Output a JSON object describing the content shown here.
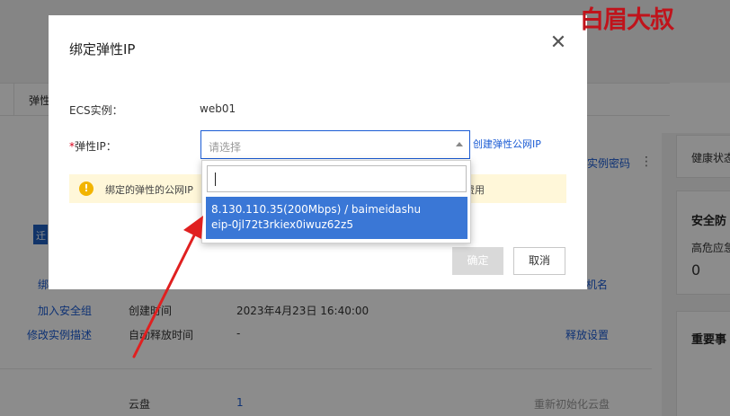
{
  "watermark": {
    "text": "白眉大叔"
  },
  "background": {
    "tab_label": "弹性",
    "chip_label": "迁",
    "rows": [
      {
        "action": "绑",
        "key": "",
        "value": "",
        "right": "机名"
      },
      {
        "action": "加入安全组",
        "key": "创建时间",
        "value": "2023年4月23日 16:40:00",
        "right": ""
      },
      {
        "action": "修改实例描述",
        "key": "自动释放时间",
        "value": "-",
        "right": "释放设置"
      }
    ],
    "disk_row": {
      "key": "云盘",
      "value": "1",
      "right": "重新初始化云盘"
    },
    "instance_password": "实例密码",
    "side": {
      "health": "健康状态",
      "security": "安全防",
      "risk": "高危应急",
      "risk_count": "0",
      "events": "重要事"
    }
  },
  "dialog": {
    "title": "绑定弹性IP",
    "ecs_label": "ECS实例：",
    "ecs_value": "web01",
    "required_mark": "*",
    "eip_label": "弹性IP：",
    "select_placeholder": "请选择",
    "create_link": "创建弹性公网IP",
    "notice_text": "绑定的弹性的公网IP",
    "notice_tail": "费用",
    "confirm_label": "确定",
    "cancel_label": "取消"
  },
  "dropdown": {
    "search_value": "",
    "options": [
      {
        "line1": "8.130.110.35(200Mbps) / baimeidashu",
        "line2": "eip-0jl72t3rkiex0iwuz62z5"
      }
    ]
  },
  "colors": {
    "link": "#1a5bd4",
    "option_highlight": "#3a77d6",
    "warning": "#f2b400",
    "annotation": "#e02020",
    "watermark": "#c0131b"
  }
}
